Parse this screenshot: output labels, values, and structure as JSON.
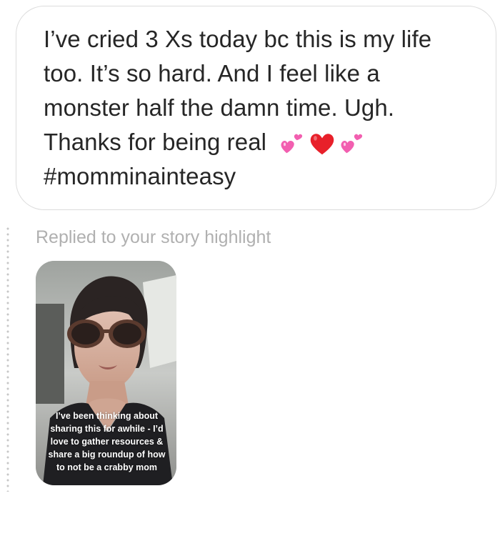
{
  "message": {
    "lines": [
      "I’ve cried 3 Xs today bc this is my life",
      "too. It’s so hard. And I feel like a",
      "monster half the damn time. Ugh.",
      "Thanks for being real",
      "#momminainteasy"
    ],
    "emojis": [
      "two-hearts-icon",
      "red-heart-icon",
      "two-hearts-icon"
    ],
    "colors": {
      "text": "#262626",
      "heart": "#e8202a",
      "pink_heart": "#f25fb0"
    }
  },
  "reply": {
    "caption": "Replied to your story highlight"
  },
  "story": {
    "overlay_lines": [
      "I’ve been thinking about",
      "sharing this for awhile - I’d",
      "love to gather resources &",
      "share a big roundup of how",
      "to not be a crabby mom"
    ]
  }
}
